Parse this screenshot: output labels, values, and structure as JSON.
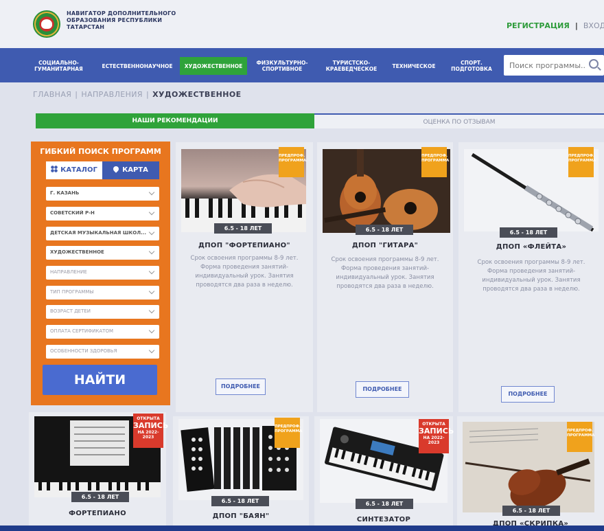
{
  "header": {
    "title_lines": [
      "НАВИГАТОР ДОПОЛНИТЕЛЬНОГО",
      "ОБРАЗОВАНИЯ РЕСПУБЛИКИ",
      "ТАТАРСТАН"
    ],
    "register_label": "РЕГИСТРАЦИЯ",
    "separator": "|",
    "login_label": "ВХОД"
  },
  "nav": {
    "items": [
      {
        "label": "СОЦИАЛЬНО-\nГУМАНИТАРНАЯ"
      },
      {
        "label": "ЕСТЕСТВЕННОНАУЧНОЕ"
      },
      {
        "label": "ХУДОЖЕСТВЕННОЕ",
        "active": true
      },
      {
        "label": "ФИЗКУЛЬТУРНО-\nСПОРТИВНОЕ"
      },
      {
        "label": "ТУРИСТСКО-\nКРАЕВЕДЧЕСКОЕ"
      },
      {
        "label": "ТЕХНИЧЕСКОЕ"
      },
      {
        "label": "СПОРТ.\nПОДГОТОВКА"
      }
    ],
    "search_placeholder": "Поиск программы..."
  },
  "breadcrumb": {
    "home": "ГЛАВНАЯ",
    "directions": "НАПРАВЛЕНИЯ",
    "current": "ХУДОЖЕСТВЕННОЕ",
    "separator": "|"
  },
  "tabs": {
    "recommendations": "НАШИ РЕКОМЕНДАЦИИ",
    "reviews": "ОЦЕНКА ПО ОТЗЫВАМ"
  },
  "filter": {
    "title": "ГИБКИЙ ПОИСК ПРОГРАММ",
    "catalog_label": "КАТАЛОГ",
    "map_label": "КАРТА",
    "selects": [
      {
        "value": "Г. КАЗАНЬ",
        "placeholder": false
      },
      {
        "value": "СОВЕТСКИЙ Р-Н",
        "placeholder": false
      },
      {
        "value": "ДЕТСКАЯ МУЗЫКАЛЬНАЯ ШКОЛ...",
        "placeholder": false
      },
      {
        "value": "ХУДОЖЕСТВЕННОЕ",
        "placeholder": false
      },
      {
        "value": "НАПРАВЛЕНИЕ",
        "placeholder": true
      },
      {
        "value": "ТИП ПРОГРАММЫ",
        "placeholder": true
      },
      {
        "value": "ВОЗРАСТ ДЕТЕЙ",
        "placeholder": true
      },
      {
        "value": "ОПЛАТА СЕРТИФИКАТОМ",
        "placeholder": true
      },
      {
        "value": "ОСОБЕННОСТИ ЗДОРОВЬЯ",
        "placeholder": true
      }
    ],
    "find_label": "НАЙТИ"
  },
  "badges": {
    "preprof": [
      "ПРЕДПРОФ.",
      "ПРОГРАММА"
    ],
    "open": [
      "ОТКРЫТА",
      "ЗАПИСЬ",
      "НА 2022-2023"
    ]
  },
  "cards": [
    {
      "title": "ДПОП \"ФОРТЕПИАНО\"",
      "age": "6.5 - 18 ЛЕТ",
      "badge": "preprof",
      "desc": "Срок освоения программы 8-9 лет. Форма проведения занятий- индивидуальный урок. Занятия проводятся два раза в неделю.",
      "more": "ПОДРОБНЕЕ"
    },
    {
      "title": "ДПОП \"ГИТАРА\"",
      "age": "6.5 - 18 ЛЕТ",
      "badge": "preprof",
      "desc": "Срок освоения программы 8-9 лет. Форма проведения занятий- индивидуальный урок. Занятия проводятся два раза в неделю.",
      "more": "ПОДРОБНЕЕ"
    },
    {
      "title": "ДПОП «ФЛЕЙТА»",
      "age": "6.5 - 18 ЛЕТ",
      "badge": "preprof",
      "desc": "Срок освоения программы 8-9 лет. Форма проведения занятий- индивидуальный урок. Занятия проводятся два раза в неделю.",
      "more": "ПОДРОБНЕЕ"
    },
    {
      "title": "ФОРТЕПИАНО",
      "age": "6.5 - 18 ЛЕТ",
      "badge": "open"
    },
    {
      "title": "ДПОП \"БАЯН\"",
      "age": "6.5 - 18 ЛЕТ",
      "badge": "preprof"
    },
    {
      "title": "СИНТЕЗАТОР",
      "age": "6.5 - 18 ЛЕТ",
      "badge": "open"
    },
    {
      "title": "ДПОП «СКРИПКА»",
      "age": "6.5 - 18 ЛЕТ",
      "badge": "preprof"
    }
  ],
  "colors": {
    "nav_blue": "#3f5bb0",
    "accent_green": "#2fa33a",
    "filter_orange": "#e8761f",
    "badge_orange": "#f0a21c",
    "badge_red": "#d93a2c"
  },
  "icons": {
    "logo": "tatarstan-emblem",
    "catalog": "grid-icon",
    "map": "map-pin-icon",
    "search": "search-icon",
    "dropdown": "chevron-down-icon"
  }
}
